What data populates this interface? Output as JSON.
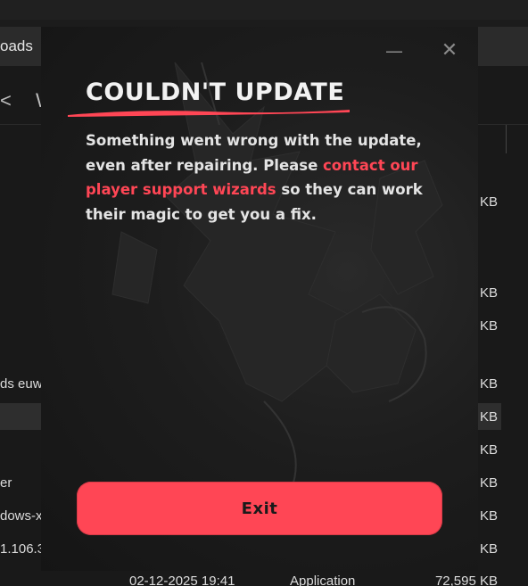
{
  "explorer": {
    "tab_label": "oads",
    "toolbar_glyphs": [
      "<",
      "W"
    ],
    "rows": [
      {
        "name": "",
        "size": "KB"
      },
      {
        "name": "",
        "size": "KB"
      },
      {
        "name": "",
        "size": "KB"
      },
      {
        "name": "ds euw",
        "size": "KB"
      },
      {
        "name": "",
        "size": "KB"
      },
      {
        "name": "",
        "size": "KB"
      },
      {
        "name": "er",
        "size": "KB"
      },
      {
        "name": "dows-x",
        "size": "KB"
      },
      {
        "name": "1.106.3",
        "size": "KB"
      }
    ],
    "last_row": {
      "date": "02-12-2025 19:41",
      "type": "Application",
      "size": "72,595 KB"
    }
  },
  "dialog": {
    "minimize_glyph": "—",
    "close_glyph": "✕",
    "title": "COULDN'T UPDATE",
    "message_before": "Something went wrong with the update, even after repairing. Please ",
    "message_link": "contact our player support wizards",
    "message_after": " so they can work their magic to get you a fix.",
    "exit_label": "Exit",
    "accent_color": "#ff4655",
    "icons": [
      "minimize-icon",
      "close-icon"
    ]
  }
}
